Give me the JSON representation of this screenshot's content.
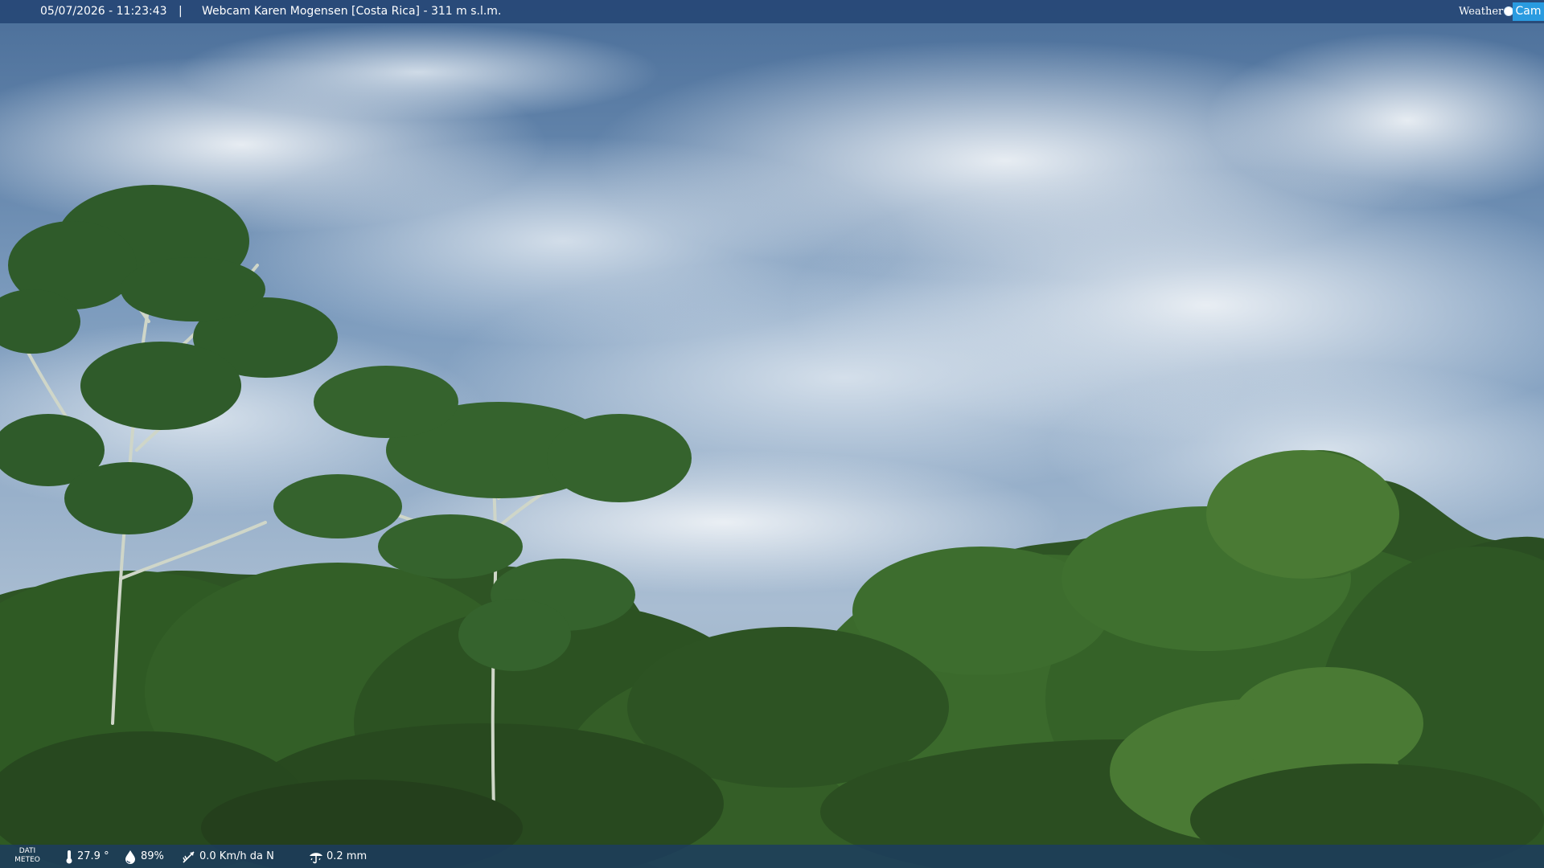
{
  "overlay": {
    "datetime": "05/07/2026 - 11:23:43",
    "separator": "|",
    "caption": "Webcam Karen Mogensen [Costa Rica] - 311 m s.l.m.",
    "logo": {
      "word": "Weather",
      "badge": "Cam"
    }
  },
  "meteo": {
    "label_line1": "DATI",
    "label_line2": "METEO",
    "temperature": "27.9 °",
    "humidity": "89%",
    "wind": "0.0 Km/h da N",
    "rain": "0.2 mm",
    "icons": [
      "thermometer-icon",
      "humidity-drop-icon",
      "wind-vane-icon",
      "rain-gauge-icon"
    ]
  },
  "colors": {
    "top_bar": "#244674",
    "bottom_bar": "#1c3c60",
    "logo_badge": "#2a9be0",
    "sky": "#5b7da3",
    "foliage": "#2f5a24"
  }
}
